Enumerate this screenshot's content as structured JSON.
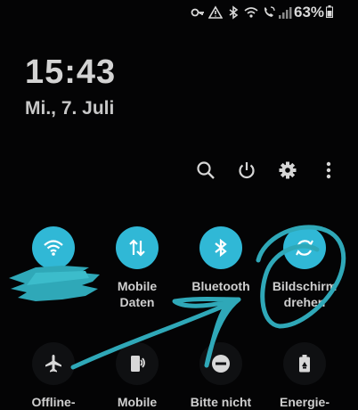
{
  "status_bar": {
    "battery_percent": "63%",
    "icons": [
      "key-icon",
      "alert-icon",
      "bluetooth-icon",
      "wifi-call-icon",
      "vowifi-icon",
      "signal-icon",
      "battery-icon"
    ]
  },
  "lock": {
    "time": "15:43",
    "date": "Mi., 7. Juli"
  },
  "toolbar": {
    "icons": [
      "search-icon",
      "power-icon",
      "gear-icon",
      "more-vertical-icon"
    ]
  },
  "tiles": [
    {
      "label": "",
      "icon": "wifi-icon",
      "active": true
    },
    {
      "label": "Mobile\nDaten",
      "icon": "data-arrows-icon",
      "active": true
    },
    {
      "label": "Bluetooth",
      "icon": "bluetooth-icon",
      "active": true
    },
    {
      "label": "Bildschirm\ndrehen",
      "icon": "rotate-icon",
      "active": true
    },
    {
      "label": "Offline-",
      "icon": "airplane-icon",
      "active": false
    },
    {
      "label": "Mobile",
      "icon": "mobile-hotspot-icon",
      "active": false
    },
    {
      "label": "Bitte nicht",
      "icon": "do-not-disturb-icon",
      "active": false
    },
    {
      "label": "Energie-",
      "icon": "battery-saver-icon",
      "active": false
    }
  ],
  "colors": {
    "accent": "#30b8d6",
    "background": "#040405",
    "scribble": "#2fa8b8"
  }
}
